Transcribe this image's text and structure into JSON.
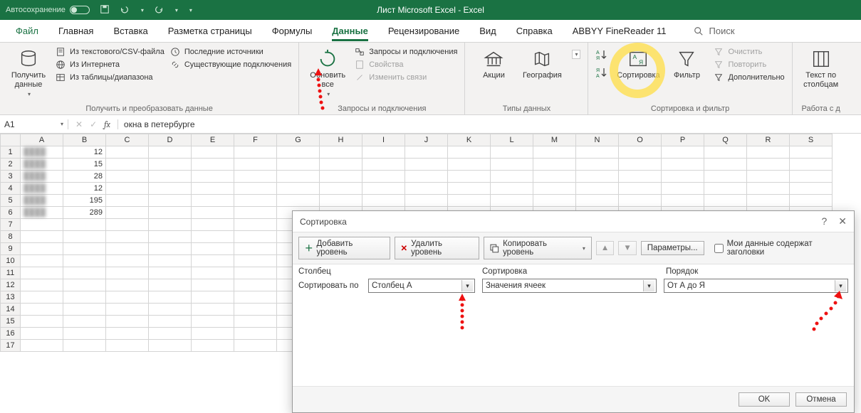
{
  "titlebar": {
    "autosave": "Автосохранение",
    "document": "Лист Microsoft Excel  -  Excel"
  },
  "menu": {
    "file": "Файл",
    "home": "Главная",
    "insert": "Вставка",
    "layout": "Разметка страницы",
    "formulas": "Формулы",
    "data": "Данные",
    "review": "Рецензирование",
    "view": "Вид",
    "help": "Справка",
    "abbyy": "ABBYY FineReader 11",
    "search": "Поиск"
  },
  "ribbon": {
    "get_data": "Получить данные",
    "from_csv": "Из текстового/CSV-файла",
    "from_web": "Из Интернета",
    "from_range": "Из таблицы/диапазона",
    "recent_src": "Последние источники",
    "existing_conn": "Существующие подключения",
    "group1": "Получить и преобразовать данные",
    "refresh_all": "Обновить все",
    "queries": "Запросы и подключения",
    "props": "Свойства",
    "edit_links": "Изменить связи",
    "group2": "Запросы и подключения",
    "stocks": "Акции",
    "geo": "География",
    "group3": "Типы данных",
    "sort": "Сортировка",
    "filter": "Фильтр",
    "clear": "Очистить",
    "reapply": "Повторить",
    "advanced": "Дополнительно",
    "group4": "Сортировка и фильтр",
    "text_to_cols": "Текст по столбцам",
    "group5": "Работа с д"
  },
  "formula": {
    "cell": "A1",
    "value": "окна в петербурге"
  },
  "columns": [
    "A",
    "B",
    "C",
    "D",
    "E",
    "F",
    "G",
    "H",
    "I",
    "J",
    "K",
    "L",
    "M",
    "N",
    "O",
    "P",
    "Q",
    "R",
    "S"
  ],
  "rows": [
    1,
    2,
    3,
    4,
    5,
    6,
    7,
    8,
    9,
    10,
    11,
    12,
    13,
    14,
    15,
    16,
    17
  ],
  "cells": {
    "A": [
      "████",
      "████",
      "████",
      "████",
      "████",
      "████"
    ],
    "B": [
      12,
      15,
      28,
      12,
      195,
      289
    ]
  },
  "dialog": {
    "title": "Сортировка",
    "add_level": "Добавить уровень",
    "del_level": "Удалить уровень",
    "copy_level": "Копировать уровень",
    "params": "Параметры...",
    "headers_chk": "Мои данные содержат заголовки",
    "col_hdr": "Столбец",
    "sort_hdr": "Сортировка",
    "order_hdr": "Порядок",
    "sort_by": "Сортировать по",
    "col_val": "Столбец A",
    "sort_val": "Значения ячеек",
    "order_val": "От А до Я",
    "ok": "OK",
    "cancel": "Отмена"
  }
}
